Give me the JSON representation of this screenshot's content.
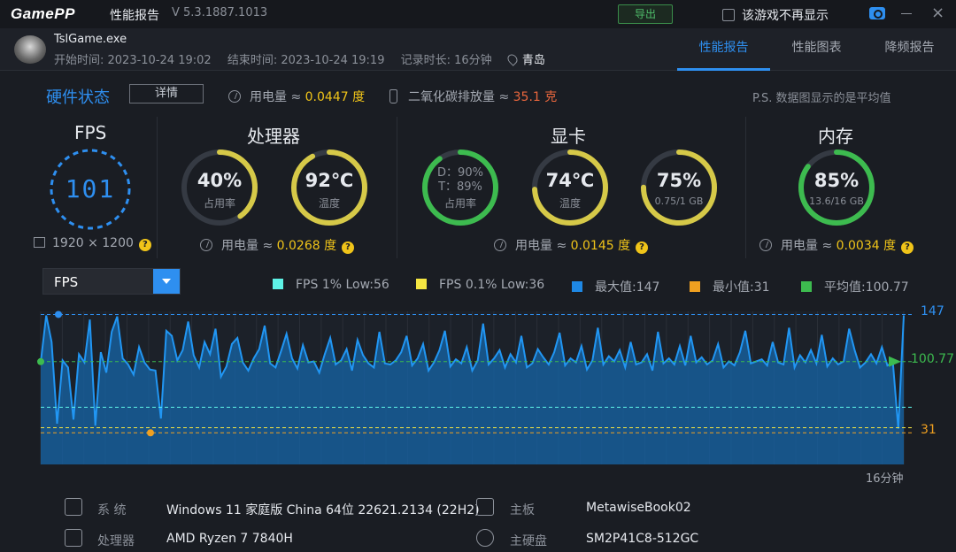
{
  "titlebar": {
    "logo": "GamePP",
    "title": "性能报告",
    "version": "V 5.3.1887.1013",
    "export_label": "导出",
    "no_show_label": "该游戏不再显示"
  },
  "game": {
    "exe": "TslGame.exe",
    "start": "开始时间: 2023-10-24 19:02",
    "end": "结束时间: 2023-10-24 19:19",
    "duration": "记录时长: 16分钟",
    "location": "青岛"
  },
  "tabs": [
    {
      "label": "性能报告",
      "active": true
    },
    {
      "label": "性能图表",
      "active": false
    },
    {
      "label": "降频报告",
      "active": false
    }
  ],
  "hardware": {
    "title": "硬件状态",
    "detail_label": "详情",
    "power_label": "用电量 ≈ ",
    "power_value": "0.0447 度",
    "co2_label": "二氧化碳排放量 ≈ ",
    "co2_value": "35.1 克",
    "note": "P.S. 数据图显示的是平均值"
  },
  "fps": {
    "title": "FPS",
    "value": "101",
    "resolution": "1920 × 1200"
  },
  "cpu": {
    "title": "处理器",
    "usage_value": "40%",
    "usage_label": "占用率",
    "usage_pct": 40,
    "temp_value": "92℃",
    "temp_label": "温度",
    "temp_pct": 92,
    "power_label": "用电量 ≈ ",
    "power_value": "0.0268 度"
  },
  "gpu": {
    "title": "显卡",
    "usage_d": "D：90%",
    "usage_t": "T：89%",
    "usage_label": "占用率",
    "usage_pct": 90,
    "temp_value": "74℃",
    "temp_label": "温度",
    "temp_pct": 74,
    "vram_value": "75%",
    "vram_label": "0.75/1 GB",
    "vram_pct": 75,
    "power_label": "用电量 ≈ ",
    "power_value": "0.0145 度"
  },
  "memory": {
    "title": "内存",
    "value": "85%",
    "label": "13.6/16 GB",
    "pct": 85,
    "power_label": "用电量 ≈ ",
    "power_value": "0.0034 度"
  },
  "chart_controls": {
    "metric": "FPS",
    "legend": [
      {
        "label": "FPS 1% Low:56",
        "color": "#5ef2e6"
      },
      {
        "label": "FPS 0.1% Low:36",
        "color": "#f5e642"
      },
      {
        "label": "最大值:147",
        "color": "#1e88e5"
      },
      {
        "label": "最小值:31",
        "color": "#f0a020"
      },
      {
        "label": "平均值:100.77",
        "color": "#3dbb4f"
      }
    ]
  },
  "chart_data": {
    "type": "area",
    "series": [
      {
        "name": "FPS",
        "values": [
          100,
          146,
          120,
          40,
          102,
          95,
          44,
          108,
          100,
          142,
          38,
          110,
          90,
          130,
          145,
          104,
          98,
          88,
          115,
          100,
          93,
          92,
          45,
          131,
          126,
          102,
          112,
          140,
          107,
          95,
          120,
          108,
          133,
          86,
          96,
          118,
          124,
          100,
          92,
          104,
          113,
          136,
          99,
          95,
          111,
          128,
          104,
          94,
          117,
          100,
          101,
          90,
          108,
          124,
          98,
          102,
          113,
          92,
          122,
          107,
          99,
          95,
          130,
          99,
          98,
          102,
          110,
          126,
          97,
          104,
          118,
          92,
          100,
          112,
          131,
          96,
          103,
          99,
          115,
          92,
          102,
          138,
          98,
          104,
          112,
          95,
          108,
          100,
          126,
          95,
          99,
          113,
          105,
          98,
          110,
          129,
          97,
          104,
          100,
          116,
          93,
          102,
          134,
          98,
          106,
          101,
          112,
          95,
          120,
          98,
          100,
          108,
          92,
          130,
          99,
          104,
          98,
          116,
          97,
          126,
          100,
          105,
          98,
          102,
          118,
          95,
          101,
          97,
          110,
          131,
          99,
          101,
          103,
          97,
          120,
          100,
          98,
          134,
          95,
          107,
          100,
          112,
          99,
          127,
          96,
          104,
          98,
          101,
          133,
          112,
          95,
          100,
          108,
          99,
          115,
          97,
          100,
          35,
          146
        ]
      }
    ],
    "x_label": "16分钟",
    "y_ticks": [
      147,
      100.77,
      31
    ],
    "reference_lines": {
      "max": 147,
      "avg": 100.77,
      "min": 31,
      "low1": 56,
      "low01": 36
    }
  },
  "system": {
    "os_label": "系  统",
    "os_value": "Windows 11 家庭版 China 64位 22621.2134 (22H2)",
    "cpu_label": "处理器",
    "cpu_value": "AMD Ryzen 7 7840H",
    "board_label": "主板",
    "board_value": "MetawiseBook02",
    "disk_label": "主硬盘",
    "disk_value": "SM2P41C8-512GC"
  }
}
